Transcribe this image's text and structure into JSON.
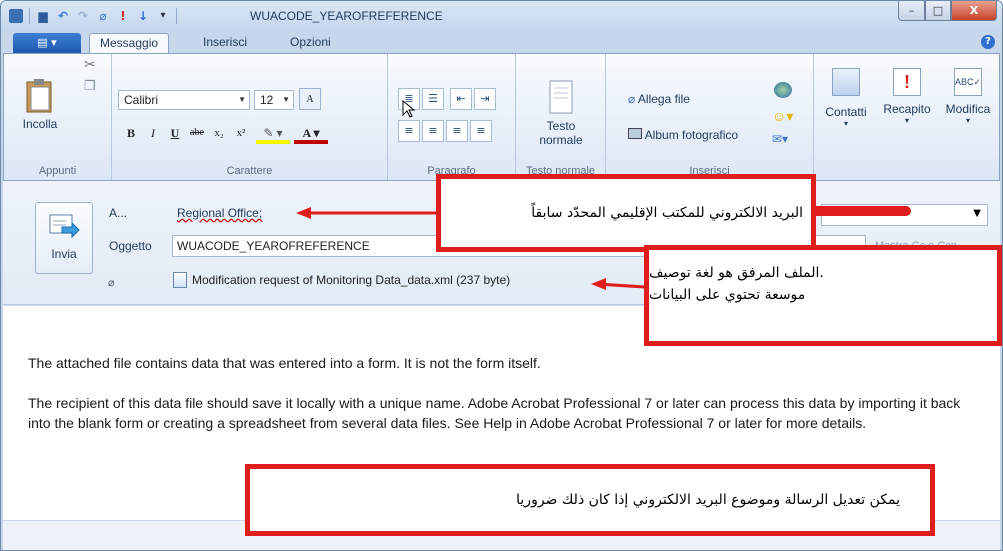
{
  "window": {
    "title": "WUACODE_YEAROFREFERENCE",
    "controls": {
      "minimize": "–",
      "maximize": "□",
      "close": "X"
    }
  },
  "quick_access": [
    "save-icon",
    "undo-icon",
    "redo-icon",
    "attach-icon",
    "importance-icon",
    "down-arrow-icon",
    "customize-icon"
  ],
  "ribbon": {
    "tabs": [
      "Messaggio",
      "Inserisci",
      "Opzioni"
    ],
    "active_tab": "Messaggio",
    "clipboard": {
      "paste_label": "Incolla",
      "group_label": "Appunti"
    },
    "font": {
      "name": "Calibri",
      "size": "12",
      "group_label": "Carattere"
    },
    "paragraph": {
      "group_label": "Paragrafo"
    },
    "normal_text": {
      "label_line1": "Testo",
      "label_line2": "normale",
      "group_label": "Testo normale"
    },
    "insert": {
      "attach_label": "Allega file",
      "album_label": "Album fotografico",
      "group_label": "Inserisci"
    },
    "contacts_label": "Contatti",
    "delivery_label": "Recapito",
    "edit_label": "Modifica"
  },
  "header": {
    "send_label": "Invia",
    "to_label": "A...",
    "to_value": "Regional Office;",
    "subject_label": "Oggetto",
    "subject_value": "WUACODE_YEAROFREFERENCE",
    "attachment": "Modification request of Monitoring Data_data.xml (237 byte)",
    "faded_label": "Mostra Cc e Ccn"
  },
  "body": {
    "paragraph1": "The attached file contains data that was entered into a form. It is not the form itself.",
    "paragraph2": "The recipient of this data file should save it locally with a unique name. Adobe Acrobat Professional 7 or later can process this data by importing it back into the blank form or creating a spreadsheet from several data files. See Help in Adobe Acrobat Professional 7 or later for more details."
  },
  "annotations": {
    "callout1": "البريد الالكتروني للمكتب الإقليمي المحدّد سابقاً",
    "callout2_line1": ".الملف المرفق هو لغة توصيف",
    "callout2_line2": "موسعة تحتوي على البيانات",
    "callout3": "يمكن تعديل الرسالة وموضوع البريد الالكتروني إذا كان ذلك ضروريا",
    "color": "#e01d1d"
  }
}
